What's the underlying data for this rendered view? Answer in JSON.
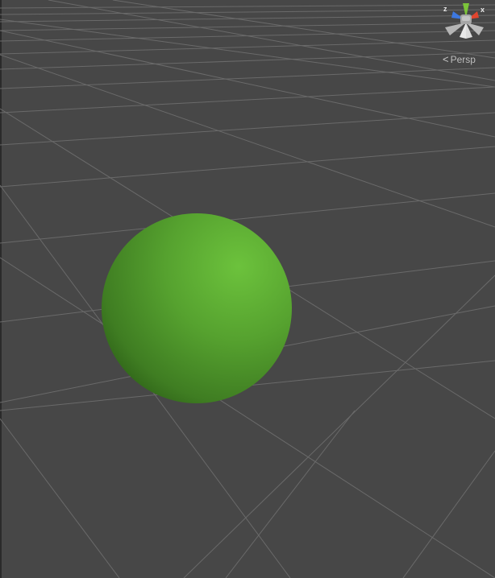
{
  "scene_view": {
    "projection_label": "Persp",
    "background_color": "#474747",
    "grid_line_color": "#6a6a6a",
    "sphere": {
      "color_highlight": "#6cc23c",
      "color_mid": "#4f9a2b",
      "color_shadow": "#2f6418"
    }
  },
  "gizmo": {
    "x_label": "x",
    "z_label": "z",
    "x_axis_color": "#e0452e",
    "y_axis_color": "#7cc43a",
    "z_axis_color": "#3d78e0"
  }
}
